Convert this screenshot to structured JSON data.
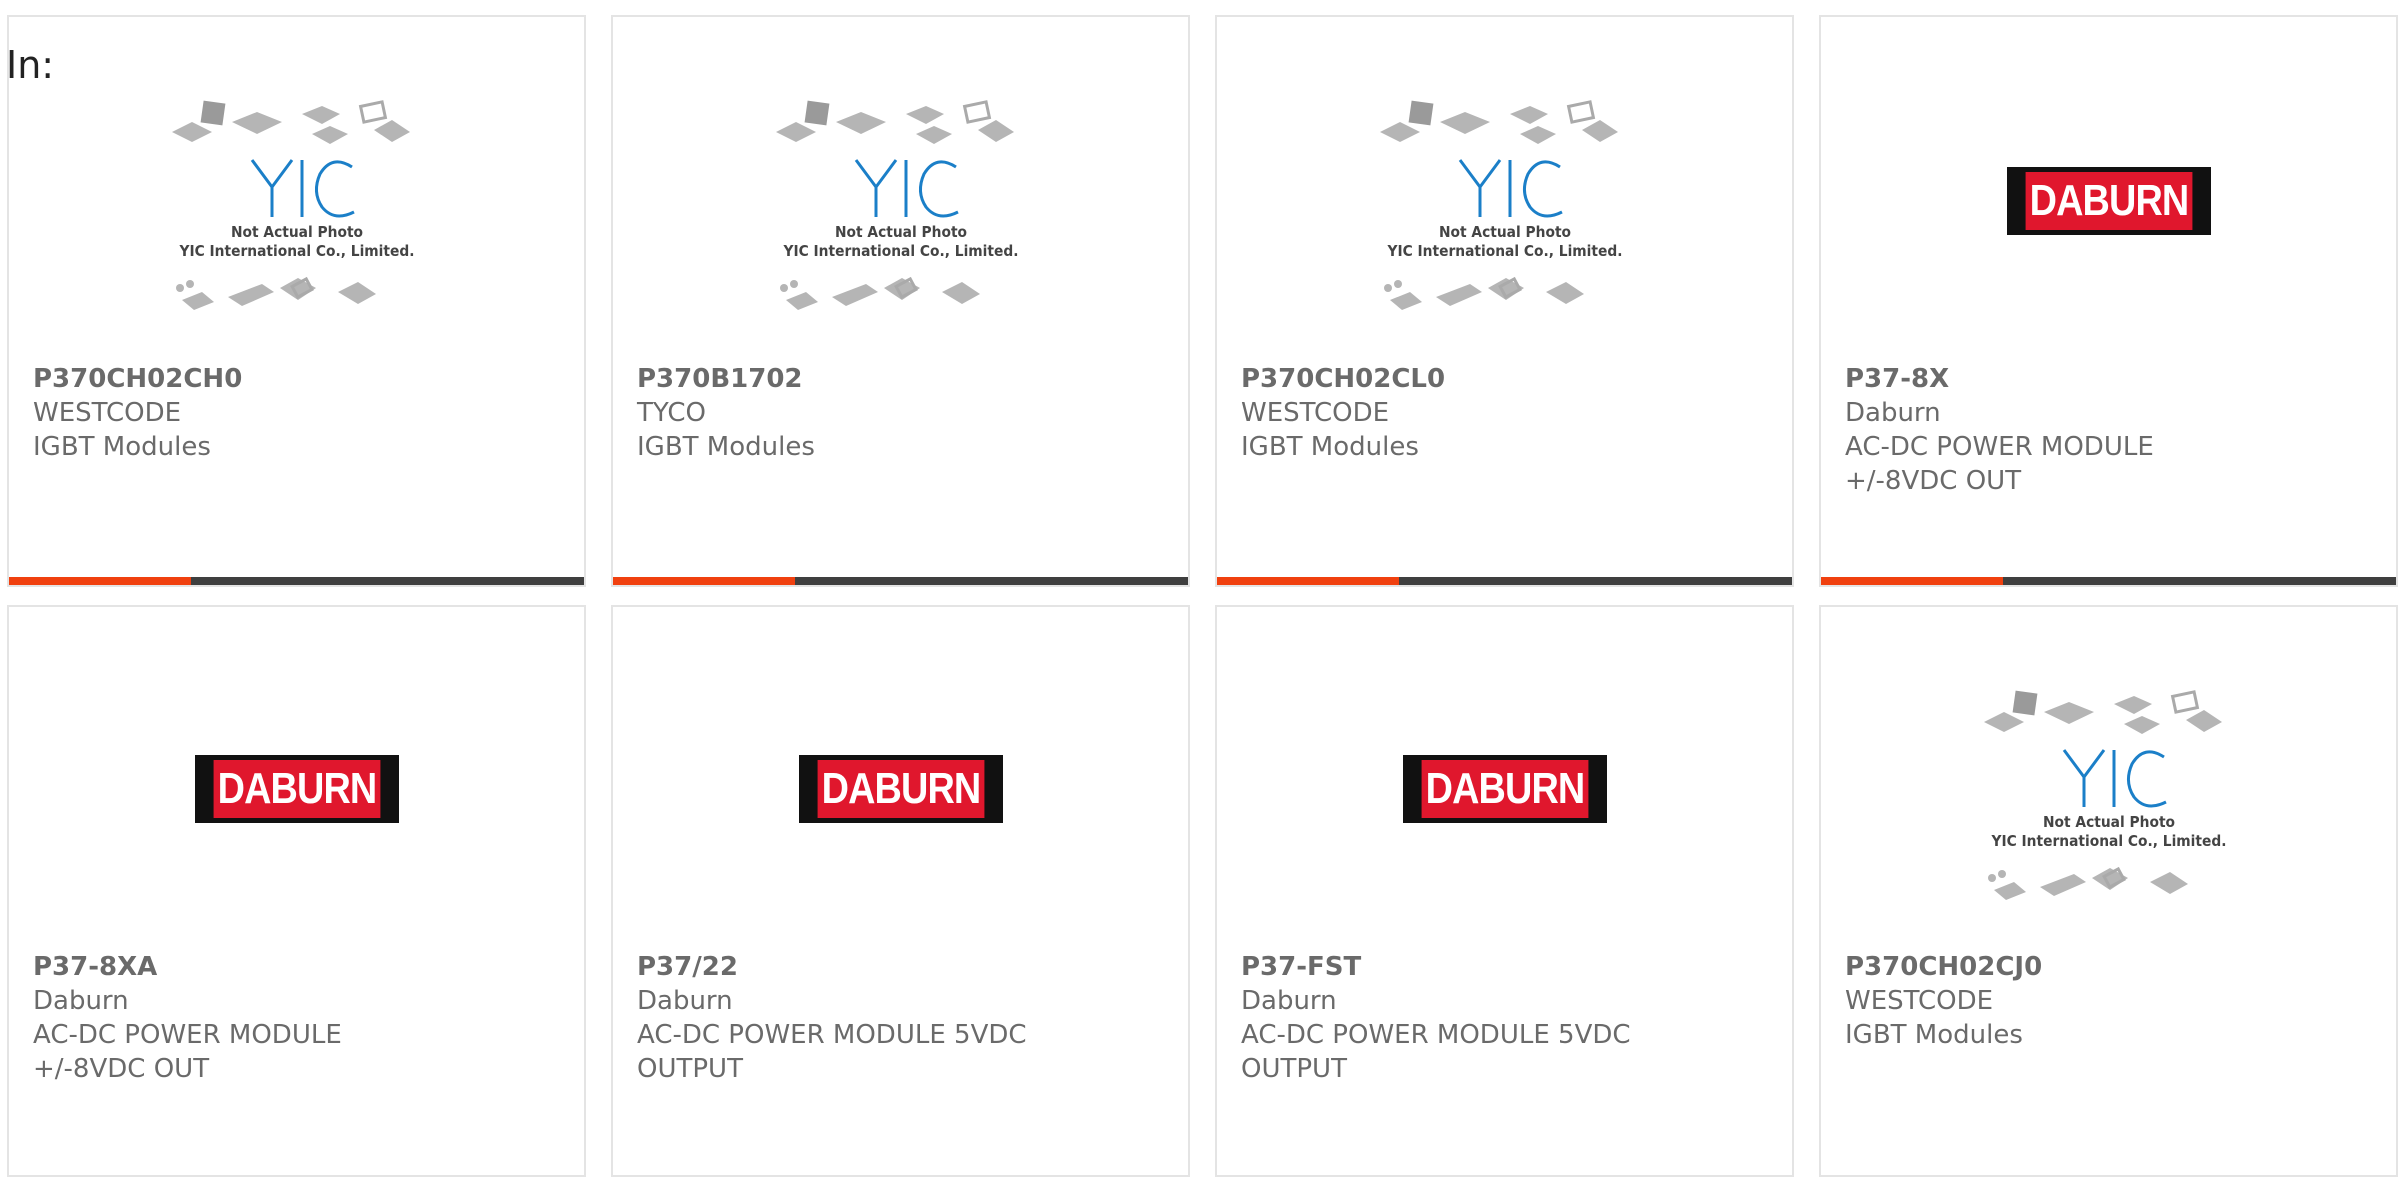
{
  "header": {
    "in_label": "In:"
  },
  "colors": {
    "accent": "#f0400f",
    "bar": "#3f3f3f",
    "daburn_red": "#e0172d"
  },
  "placeholder": {
    "caption_line1": "Not Actual Photo",
    "caption_line2": "YIC International Co., Limited.",
    "logo_text": "YIC"
  },
  "daburn_logo": {
    "text": "DABURN"
  },
  "products": [
    {
      "part": "P370CH02CH0",
      "manufacturer": "WESTCODE",
      "description": "IGBT Modules",
      "image": "yic-placeholder"
    },
    {
      "part": "P370B1702",
      "manufacturer": "TYCO",
      "description": "IGBT Modules",
      "image": "yic-placeholder"
    },
    {
      "part": "P370CH02CL0",
      "manufacturer": "WESTCODE",
      "description": "IGBT Modules",
      "image": "yic-placeholder"
    },
    {
      "part": "P37-8X",
      "manufacturer": "Daburn",
      "description": "AC-DC POWER MODULE +/-8VDC OUT",
      "image": "daburn-logo"
    },
    {
      "part": "P37-8XA",
      "manufacturer": "Daburn",
      "description": "AC-DC POWER MODULE +/-8VDC OUT",
      "image": "daburn-logo"
    },
    {
      "part": "P37/22",
      "manufacturer": "Daburn",
      "description": "AC-DC POWER MODULE 5VDC OUTPUT",
      "image": "daburn-logo"
    },
    {
      "part": "P37-FST",
      "manufacturer": "Daburn",
      "description": "AC-DC POWER MODULE 5VDC OUTPUT",
      "image": "daburn-logo"
    },
    {
      "part": "P370CH02CJ0",
      "manufacturer": "WESTCODE",
      "description": "IGBT Modules",
      "image": "yic-placeholder"
    }
  ]
}
